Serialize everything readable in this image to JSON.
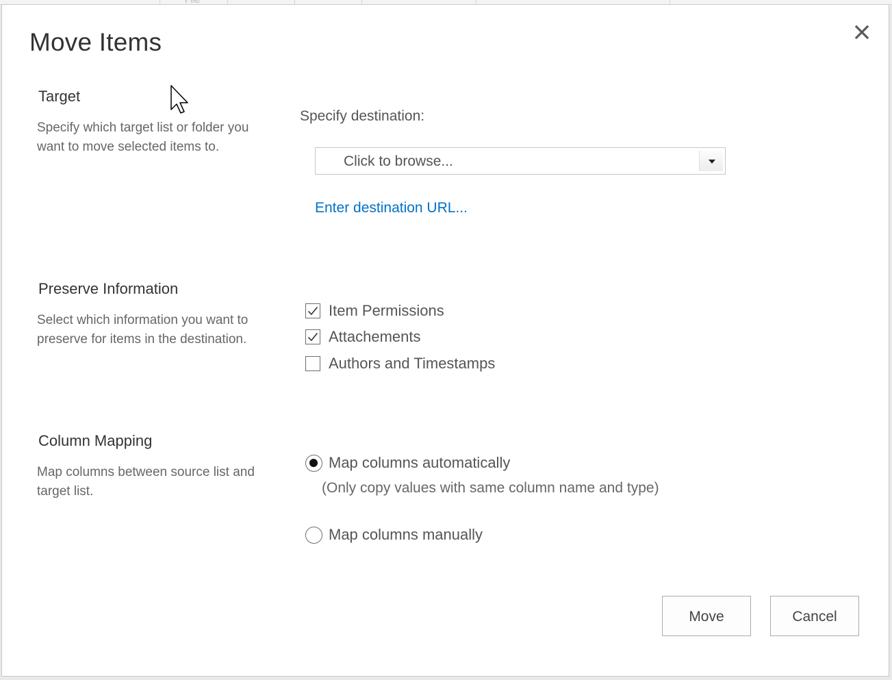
{
  "dialog": {
    "title": "Move Items",
    "close_icon": "close-icon"
  },
  "target": {
    "heading": "Target",
    "description": "Specify which target list or folder you want to move selected items to.",
    "destination_label": "Specify destination:",
    "browse_placeholder": "Click to browse...",
    "url_link": "Enter destination URL..."
  },
  "preserve": {
    "heading": "Preserve Information",
    "description": "Select which information you want to preserve for items in the destination.",
    "options": [
      {
        "label": "Item Permissions",
        "checked": true
      },
      {
        "label": "Attachements",
        "checked": true
      },
      {
        "label": "Authors and Timestamps",
        "checked": false
      }
    ]
  },
  "mapping": {
    "heading": "Column Mapping",
    "description": "Map columns between source list and target list.",
    "auto_label": "Map columns automatically",
    "auto_note": "(Only copy values with same column name and type)",
    "manual_label": "Map columns manually",
    "selected": "auto"
  },
  "buttons": {
    "move": "Move",
    "cancel": "Cancel"
  },
  "colors": {
    "link": "#0072c6",
    "heading": "#333333",
    "body_text": "#666666"
  }
}
